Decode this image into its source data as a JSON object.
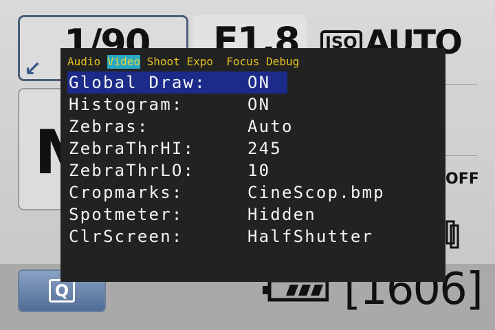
{
  "camera": {
    "shutter": "1/90",
    "aperture": "F1.8",
    "iso_badge": "ISO",
    "iso": "AUTO",
    "mode": "M",
    "flash_label": "OFF",
    "quick_button": "Q",
    "shots_remaining": "[1606]"
  },
  "menu": {
    "tabs": [
      {
        "label": "Audio",
        "active": false
      },
      {
        "label": "Video",
        "active": true
      },
      {
        "label": "Shoot",
        "active": false
      },
      {
        "label": "Expo",
        "active": false
      },
      {
        "label": "Focus",
        "active": false
      },
      {
        "label": "Debug",
        "active": false
      }
    ],
    "items": [
      {
        "label": "Global Draw:",
        "value": "ON",
        "selected": true
      },
      {
        "label": "Histogram:",
        "value": "ON",
        "selected": false
      },
      {
        "label": "Zebras:",
        "value": "Auto",
        "selected": false
      },
      {
        "label": "ZebraThrHI:",
        "value": "245",
        "selected": false
      },
      {
        "label": "ZebraThrLO:",
        "value": "10",
        "selected": false
      },
      {
        "label": "Cropmarks:",
        "value": "CineScop.bmp",
        "selected": false
      },
      {
        "label": "Spotmeter:",
        "value": "Hidden",
        "selected": false
      },
      {
        "label": "ClrScreen:",
        "value": "HalfShutter",
        "selected": false
      }
    ]
  },
  "colors": {
    "menu_background": "#222222",
    "tab_text": "#e8c321",
    "active_tab_background": "#27a7c4",
    "selected_item_background": "#1c2b8a",
    "item_text": "#f4f4f4"
  }
}
